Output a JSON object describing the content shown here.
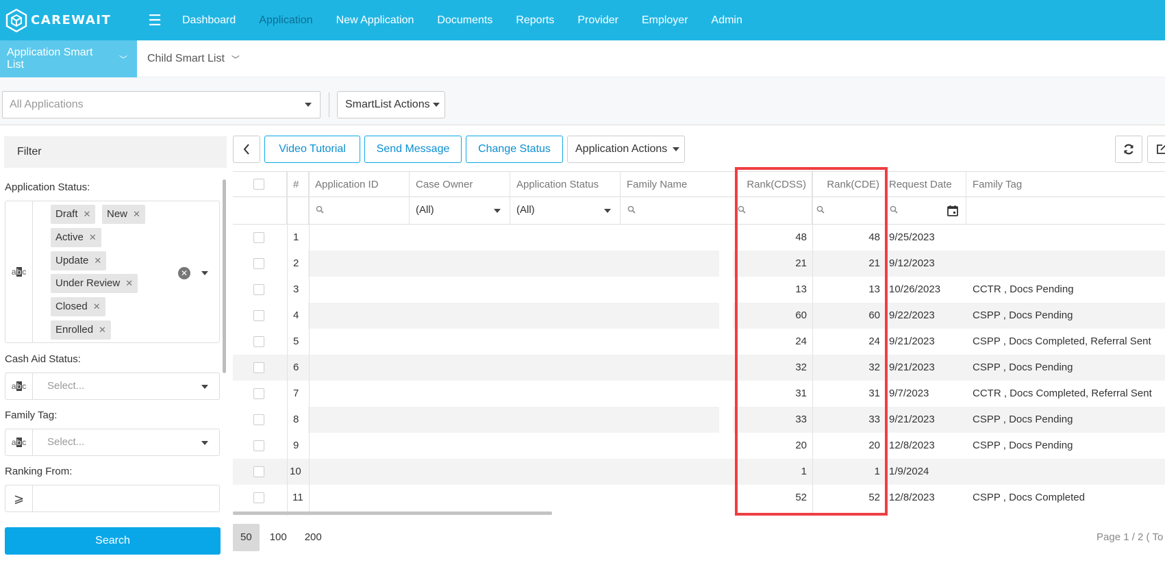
{
  "app": {
    "brand": "CAREWAIT"
  },
  "nav": {
    "items": [
      "Dashboard",
      "Application",
      "New Application",
      "Documents",
      "Reports",
      "Provider",
      "Employer",
      "Admin"
    ]
  },
  "subnav": {
    "tabs": [
      "Application Smart List",
      "Child Smart List"
    ]
  },
  "selector": {
    "list_value": "All Applications",
    "smartlist_actions": "SmartList Actions"
  },
  "filter": {
    "title": "Filter",
    "app_status_label": "Application Status:",
    "app_status_tags": [
      "Draft",
      "New",
      "Active",
      "Update",
      "Under Review",
      "Closed",
      "Enrolled"
    ],
    "cash_aid_label": "Cash Aid Status:",
    "cash_aid_placeholder": "Select...",
    "family_tag_label": "Family Tag:",
    "family_tag_placeholder": "Select...",
    "ranking_label": "Ranking From:",
    "ranking_operator": "⩾",
    "search_label": "Search"
  },
  "toolbar": {
    "video_tutorial": "Video Tutorial",
    "send_message": "Send Message",
    "change_status": "Change Status",
    "application_actions": "Application Actions"
  },
  "grid": {
    "columns": [
      "#",
      "Application ID",
      "Case Owner",
      "Application Status",
      "Family Name",
      "Rank(CDSS)",
      "Rank(CDE)",
      "Request Date",
      "Family Tag"
    ],
    "filters": {
      "case_owner": "(All)",
      "application_status": "(All)"
    },
    "rows": [
      {
        "num": "1",
        "rank_cdss": "48",
        "rank_cde": "48",
        "request_date": "9/25/2023",
        "family_tag": ""
      },
      {
        "num": "2",
        "rank_cdss": "21",
        "rank_cde": "21",
        "request_date": "9/12/2023",
        "family_tag": ""
      },
      {
        "num": "3",
        "rank_cdss": "13",
        "rank_cde": "13",
        "request_date": "10/26/2023",
        "family_tag": "CCTR , Docs Pending"
      },
      {
        "num": "4",
        "rank_cdss": "60",
        "rank_cde": "60",
        "request_date": "9/22/2023",
        "family_tag": "CSPP , Docs Pending"
      },
      {
        "num": "5",
        "rank_cdss": "24",
        "rank_cde": "24",
        "request_date": "9/21/2023",
        "family_tag": "CSPP , Docs Completed, Referral Sent"
      },
      {
        "num": "6",
        "rank_cdss": "32",
        "rank_cde": "32",
        "request_date": "9/21/2023",
        "family_tag": "CSPP , Docs Pending"
      },
      {
        "num": "7",
        "rank_cdss": "31",
        "rank_cde": "31",
        "request_date": "9/7/2023",
        "family_tag": "CCTR , Docs Completed, Referral Sent"
      },
      {
        "num": "8",
        "rank_cdss": "33",
        "rank_cde": "33",
        "request_date": "9/21/2023",
        "family_tag": "CSPP , Docs Pending"
      },
      {
        "num": "9",
        "rank_cdss": "20",
        "rank_cde": "20",
        "request_date": "12/8/2023",
        "family_tag": "CSPP , Docs Pending"
      },
      {
        "num": "10",
        "rank_cdss": "1",
        "rank_cde": "1",
        "request_date": "1/9/2024",
        "family_tag": ""
      },
      {
        "num": "11",
        "rank_cdss": "52",
        "rank_cde": "52",
        "request_date": "12/8/2023",
        "family_tag": "CSPP , Docs Completed"
      }
    ]
  },
  "pager": {
    "sizes": [
      "50",
      "100",
      "200"
    ],
    "info": "Page 1 / 2 ( To"
  },
  "colors": {
    "brand": "#1fb5e3",
    "highlight": "#ef3e42",
    "primary_button": "#0aa7e8"
  }
}
